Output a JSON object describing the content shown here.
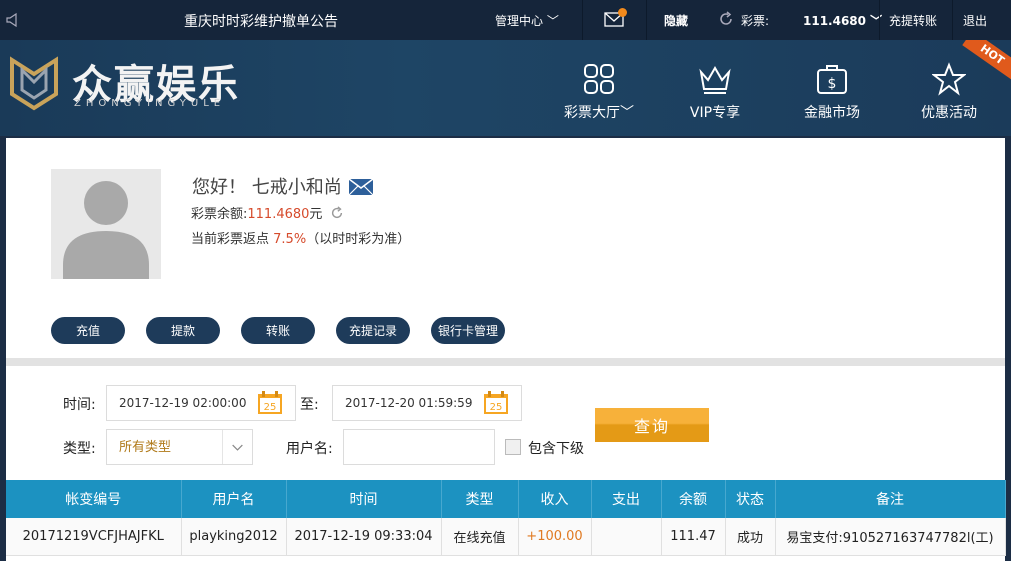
{
  "topbar": {
    "notice": "重庆时时彩维护撤单公告",
    "mgmt": "管理中心 ﹀",
    "hide": "隐藏",
    "lottery_label": "彩票:",
    "lottery_balance": "111.4680 ﹀",
    "transfer": "充提转账",
    "logout": "退出"
  },
  "header": {
    "brand": "众赢娱乐",
    "brand_sub": "ZHONGYINGYULE",
    "nav": [
      {
        "label": "彩票大厅﹀",
        "icon": "grid-icon"
      },
      {
        "label": "VIP专享",
        "icon": "crown-icon"
      },
      {
        "label": "金融市场",
        "icon": "money-bag-icon"
      },
      {
        "label": "优惠活动",
        "icon": "star-icon"
      }
    ],
    "hot_badge": "HOT"
  },
  "profile": {
    "greeting": "您好！ 七戒小和尚",
    "balance_label": "彩票余额:",
    "balance_value": "111.4680",
    "balance_unit": "元",
    "rebate_label": "当前彩票返点",
    "rebate_value": "7.5%",
    "rebate_note": "（以时时彩为准）"
  },
  "actions": [
    "充值",
    "提款",
    "转账",
    "充提记录",
    "银行卡管理"
  ],
  "filters": {
    "time_label": "时间:",
    "time_from": "2017-12-19 02:00:00",
    "to_label": "至:",
    "time_to": "2017-12-20 01:59:59",
    "calendar_day": "25",
    "type_label": "类型:",
    "type_value": "所有类型",
    "username_label": "用户名:",
    "username_value": "",
    "include_sub_label": "包含下级",
    "query_button": "查询"
  },
  "table": {
    "headers": [
      "帐变编号",
      "用户名",
      "时间",
      "类型",
      "收入",
      "支出",
      "余额",
      "状态",
      "备注"
    ],
    "rows": [
      [
        "20171219VCFJHAJFKL",
        "playking2012",
        "2017-12-19 09:33:04",
        "在线充值",
        "+100.00",
        "",
        "111.47",
        "成功",
        "易宝支付:910527163747782l(工)"
      ]
    ]
  },
  "colors": {
    "accent_orange": "#f28a1c",
    "table_header": "#1c92c1",
    "dark_button": "#1e3b5a",
    "value_red": "#d64b2c"
  }
}
